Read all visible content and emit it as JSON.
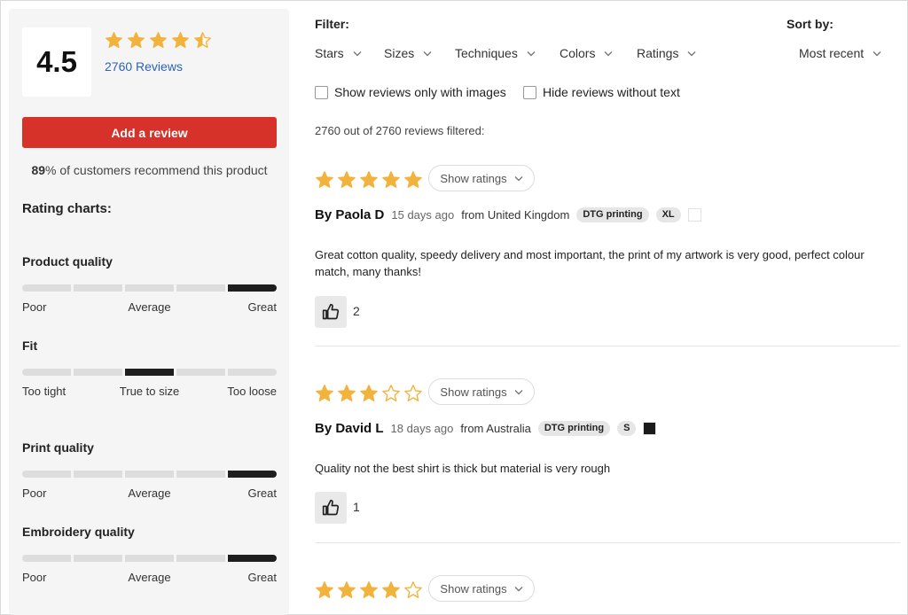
{
  "summary": {
    "score": "4.5",
    "stars": 4.5,
    "reviews_link": "2760 Reviews",
    "add_review_label": "Add a review",
    "recommend_percent": "89",
    "recommend_text": "% of customers recommend this product"
  },
  "rating_charts": {
    "title": "Rating charts:",
    "charts": [
      {
        "title": "Product quality",
        "selected_segment": 5,
        "labels": [
          "Poor",
          "Average",
          "Great"
        ]
      },
      {
        "title": "Fit",
        "selected_segment": 3,
        "labels": [
          "Too tight",
          "True to size",
          "Too loose"
        ]
      },
      {
        "title": "Print quality",
        "selected_segment": 5,
        "labels": [
          "Poor",
          "Average",
          "Great"
        ]
      },
      {
        "title": "Embroidery quality",
        "selected_segment": 5,
        "labels": [
          "Poor",
          "Average",
          "Great"
        ]
      }
    ]
  },
  "filter": {
    "label": "Filter:",
    "options": [
      "Stars",
      "Sizes",
      "Techniques",
      "Colors",
      "Ratings"
    ]
  },
  "sort": {
    "label": "Sort by:",
    "selected": "Most recent"
  },
  "checkboxes": {
    "images_only": "Show reviews only with images",
    "hide_no_text": "Hide reviews without text"
  },
  "count_text": "2760 out of 2760 reviews filtered:",
  "show_ratings_label": "Show ratings",
  "reviews": [
    {
      "stars": 5,
      "author": "By Paola D",
      "ago": "15 days ago",
      "origin": "from United Kingdom",
      "technique": "DTG printing",
      "size": "XL",
      "color": "#ffffff",
      "text": "Great cotton quality, speedy delivery and most important, the print of my artwork is very good, perfect colour match, many thanks!",
      "helpful": "2"
    },
    {
      "stars": 3,
      "author": "By David L",
      "ago": "18 days ago",
      "origin": "from Australia",
      "technique": "DTG printing",
      "size": "S",
      "color": "#1a1a1a",
      "text": "Quality not the best shirt is thick but material is very rough",
      "helpful": "1"
    },
    {
      "stars": 4
    }
  ],
  "colors": {
    "star": "#f2b33d",
    "accent_red": "#d6322a",
    "link_blue": "#2a63b8"
  }
}
